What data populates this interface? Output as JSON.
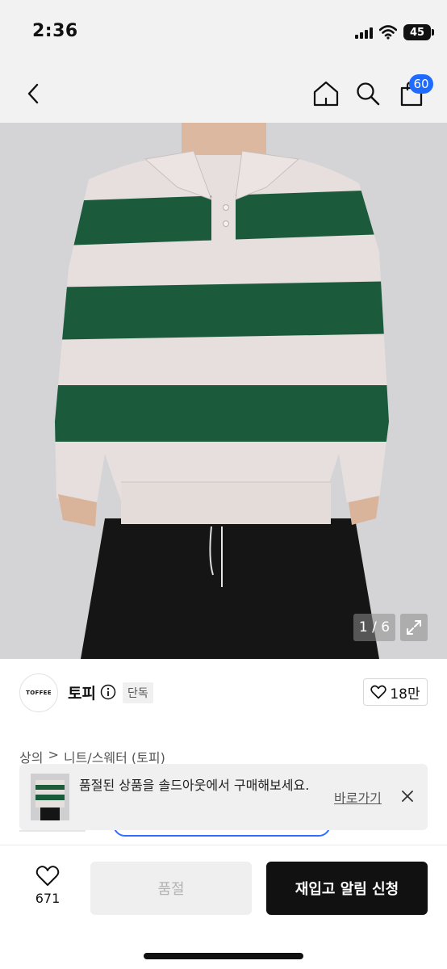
{
  "status_bar": {
    "time": "2:36",
    "battery": "45",
    "icons": [
      "cellular-signal-icon",
      "wifi-icon",
      "battery-icon"
    ]
  },
  "top_nav": {
    "icons": [
      "back-arrow-icon",
      "home-icon",
      "search-icon",
      "cart-icon"
    ],
    "cart_count": "60"
  },
  "product_image": {
    "counter": "1 / 6",
    "description_colors": {
      "stripe_green": "#1c5a3c",
      "stripe_cream": "#e6dfdd",
      "pants": "#151515",
      "background": "#d4d4d6"
    }
  },
  "brand": {
    "logo_text": "TOFFEE",
    "name": "토피",
    "badge": "단독",
    "likes": "18만"
  },
  "breadcrumb": {
    "category": "상의",
    "separator": ">",
    "subcategory": "니트/스웨터 (토피)"
  },
  "soldout_banner": {
    "message": "품절된 상품을 솔드아웃에서 구매해보세요.",
    "link_label": "바로가기"
  },
  "bottom_bar": {
    "like_count": "671",
    "soldout_label": "품절",
    "restock_label": "재입고 알림 신청"
  },
  "colors": {
    "accent_blue": "#1f6bff",
    "primary_black": "#111111",
    "disabled_gray": "#efefef"
  }
}
